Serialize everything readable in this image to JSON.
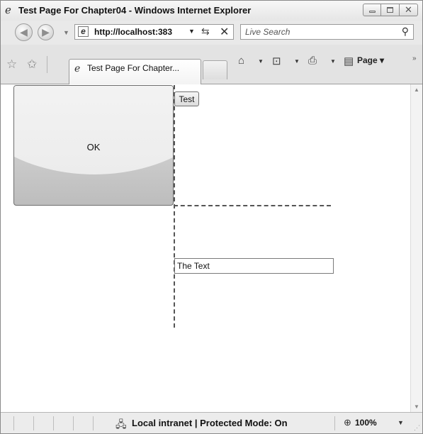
{
  "window": {
    "title": "Test Page For Chapter04 - Windows Internet Explorer",
    "icon": "ie-logo-icon"
  },
  "caption_buttons": {
    "minimize": "minimize-icon",
    "maximize": "maximize-icon",
    "close": "close-icon"
  },
  "address_bar": {
    "url": "http://localhost:383",
    "search_placeholder": "Live Search"
  },
  "tabs": [
    {
      "label": "Test Page For Chapter..."
    }
  ],
  "command_bar": {
    "page_label": "Page"
  },
  "content": {
    "ok_button_label": "OK",
    "test_button_label": "Test",
    "text_value": "The Text"
  },
  "status_bar": {
    "zone_text": "Local intranet | Protected Mode: On",
    "zoom": "100%"
  },
  "colors": {
    "chrome": "#e3e3e3",
    "border": "#9a9a9a",
    "dashed_line": "#555555"
  }
}
